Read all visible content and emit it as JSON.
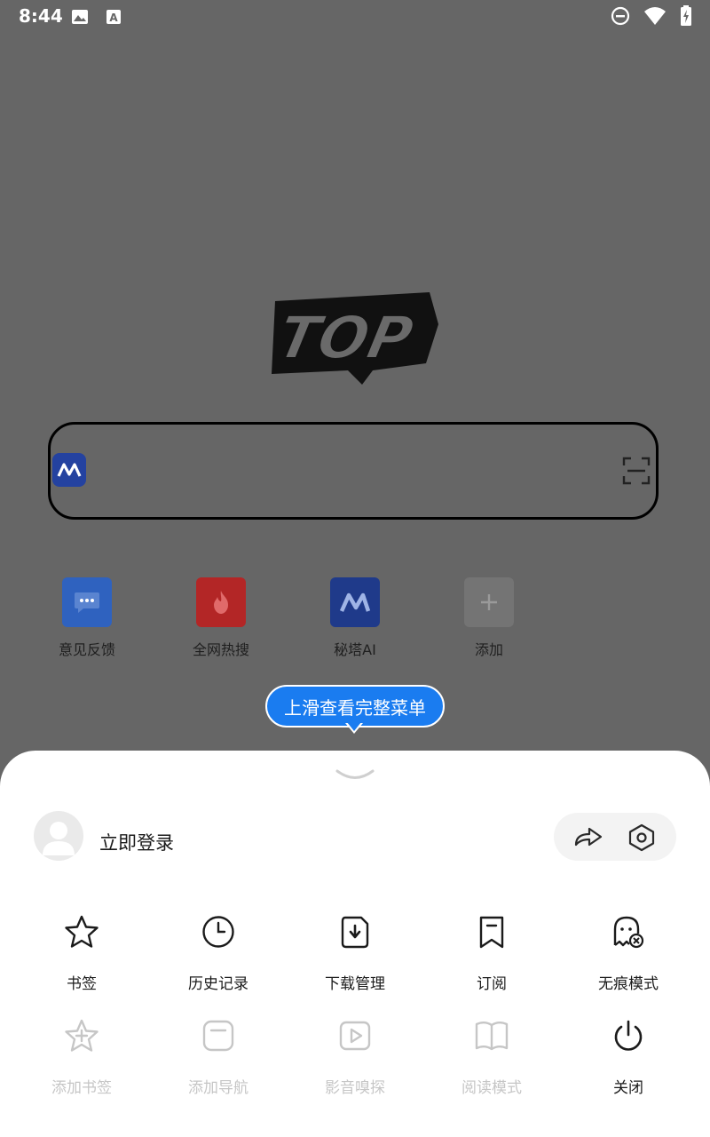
{
  "status_bar": {
    "time": "8:44",
    "icons": [
      "image-icon",
      "a-box-icon",
      "dnd-icon",
      "wifi-icon",
      "battery-icon"
    ]
  },
  "logo": {
    "text": "TOP"
  },
  "search": {
    "app_icon": "metaso-icon",
    "scan_icon": "scan-icon"
  },
  "quick_links": [
    {
      "label": "意见反馈",
      "icon": "chat-bubble-icon",
      "color": "#2f62bf"
    },
    {
      "label": "全网热搜",
      "icon": "flame-icon",
      "color": "#b32626"
    },
    {
      "label": "秘塔AI",
      "icon": "metaso-icon",
      "color": "#1f3a8a"
    },
    {
      "label": "添加",
      "icon": "plus-icon",
      "color": "#747474"
    }
  ],
  "tooltip": {
    "text": "上滑查看完整菜单"
  },
  "sheet": {
    "login_label": "立即登录",
    "menu_row1": [
      {
        "label": "书签",
        "icon": "star-icon"
      },
      {
        "label": "历史记录",
        "icon": "clock-icon"
      },
      {
        "label": "下载管理",
        "icon": "download-icon"
      },
      {
        "label": "订阅",
        "icon": "bookmark-icon"
      },
      {
        "label": "无痕模式",
        "icon": "ghost-icon"
      }
    ],
    "menu_row2": [
      {
        "label": "添加书签",
        "icon": "star-plus-icon",
        "disabled": true
      },
      {
        "label": "添加导航",
        "icon": "nav-add-icon",
        "disabled": true
      },
      {
        "label": "影音嗅探",
        "icon": "play-icon",
        "disabled": true
      },
      {
        "label": "阅读模式",
        "icon": "book-icon",
        "disabled": true
      },
      {
        "label": "关闭",
        "icon": "power-icon",
        "disabled": false
      }
    ]
  }
}
